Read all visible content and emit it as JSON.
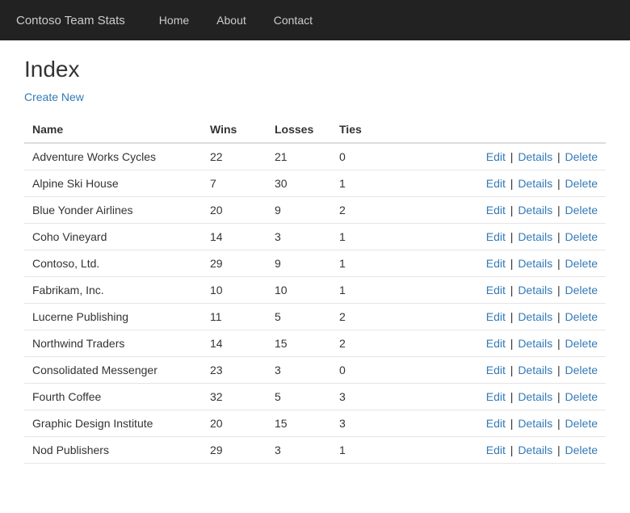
{
  "navbar": {
    "brand": "Contoso Team Stats",
    "links": [
      {
        "label": "Home",
        "href": "#"
      },
      {
        "label": "About",
        "href": "#"
      },
      {
        "label": "Contact",
        "href": "#"
      }
    ]
  },
  "page": {
    "title": "Index",
    "create_new_label": "Create New"
  },
  "table": {
    "headers": [
      "Name",
      "Wins",
      "Losses",
      "Ties",
      ""
    ],
    "rows": [
      {
        "name": "Adventure Works Cycles",
        "wins": 22,
        "losses": 21,
        "ties": 0
      },
      {
        "name": "Alpine Ski House",
        "wins": 7,
        "losses": 30,
        "ties": 1
      },
      {
        "name": "Blue Yonder Airlines",
        "wins": 20,
        "losses": 9,
        "ties": 2
      },
      {
        "name": "Coho Vineyard",
        "wins": 14,
        "losses": 3,
        "ties": 1
      },
      {
        "name": "Contoso, Ltd.",
        "wins": 29,
        "losses": 9,
        "ties": 1
      },
      {
        "name": "Fabrikam, Inc.",
        "wins": 10,
        "losses": 10,
        "ties": 1
      },
      {
        "name": "Lucerne Publishing",
        "wins": 11,
        "losses": 5,
        "ties": 2
      },
      {
        "name": "Northwind Traders",
        "wins": 14,
        "losses": 15,
        "ties": 2
      },
      {
        "name": "Consolidated Messenger",
        "wins": 23,
        "losses": 3,
        "ties": 0
      },
      {
        "name": "Fourth Coffee",
        "wins": 32,
        "losses": 5,
        "ties": 3
      },
      {
        "name": "Graphic Design Institute",
        "wins": 20,
        "losses": 15,
        "ties": 3
      },
      {
        "name": "Nod Publishers",
        "wins": 29,
        "losses": 3,
        "ties": 1
      }
    ],
    "actions": [
      "Edit",
      "Details",
      "Delete"
    ]
  }
}
